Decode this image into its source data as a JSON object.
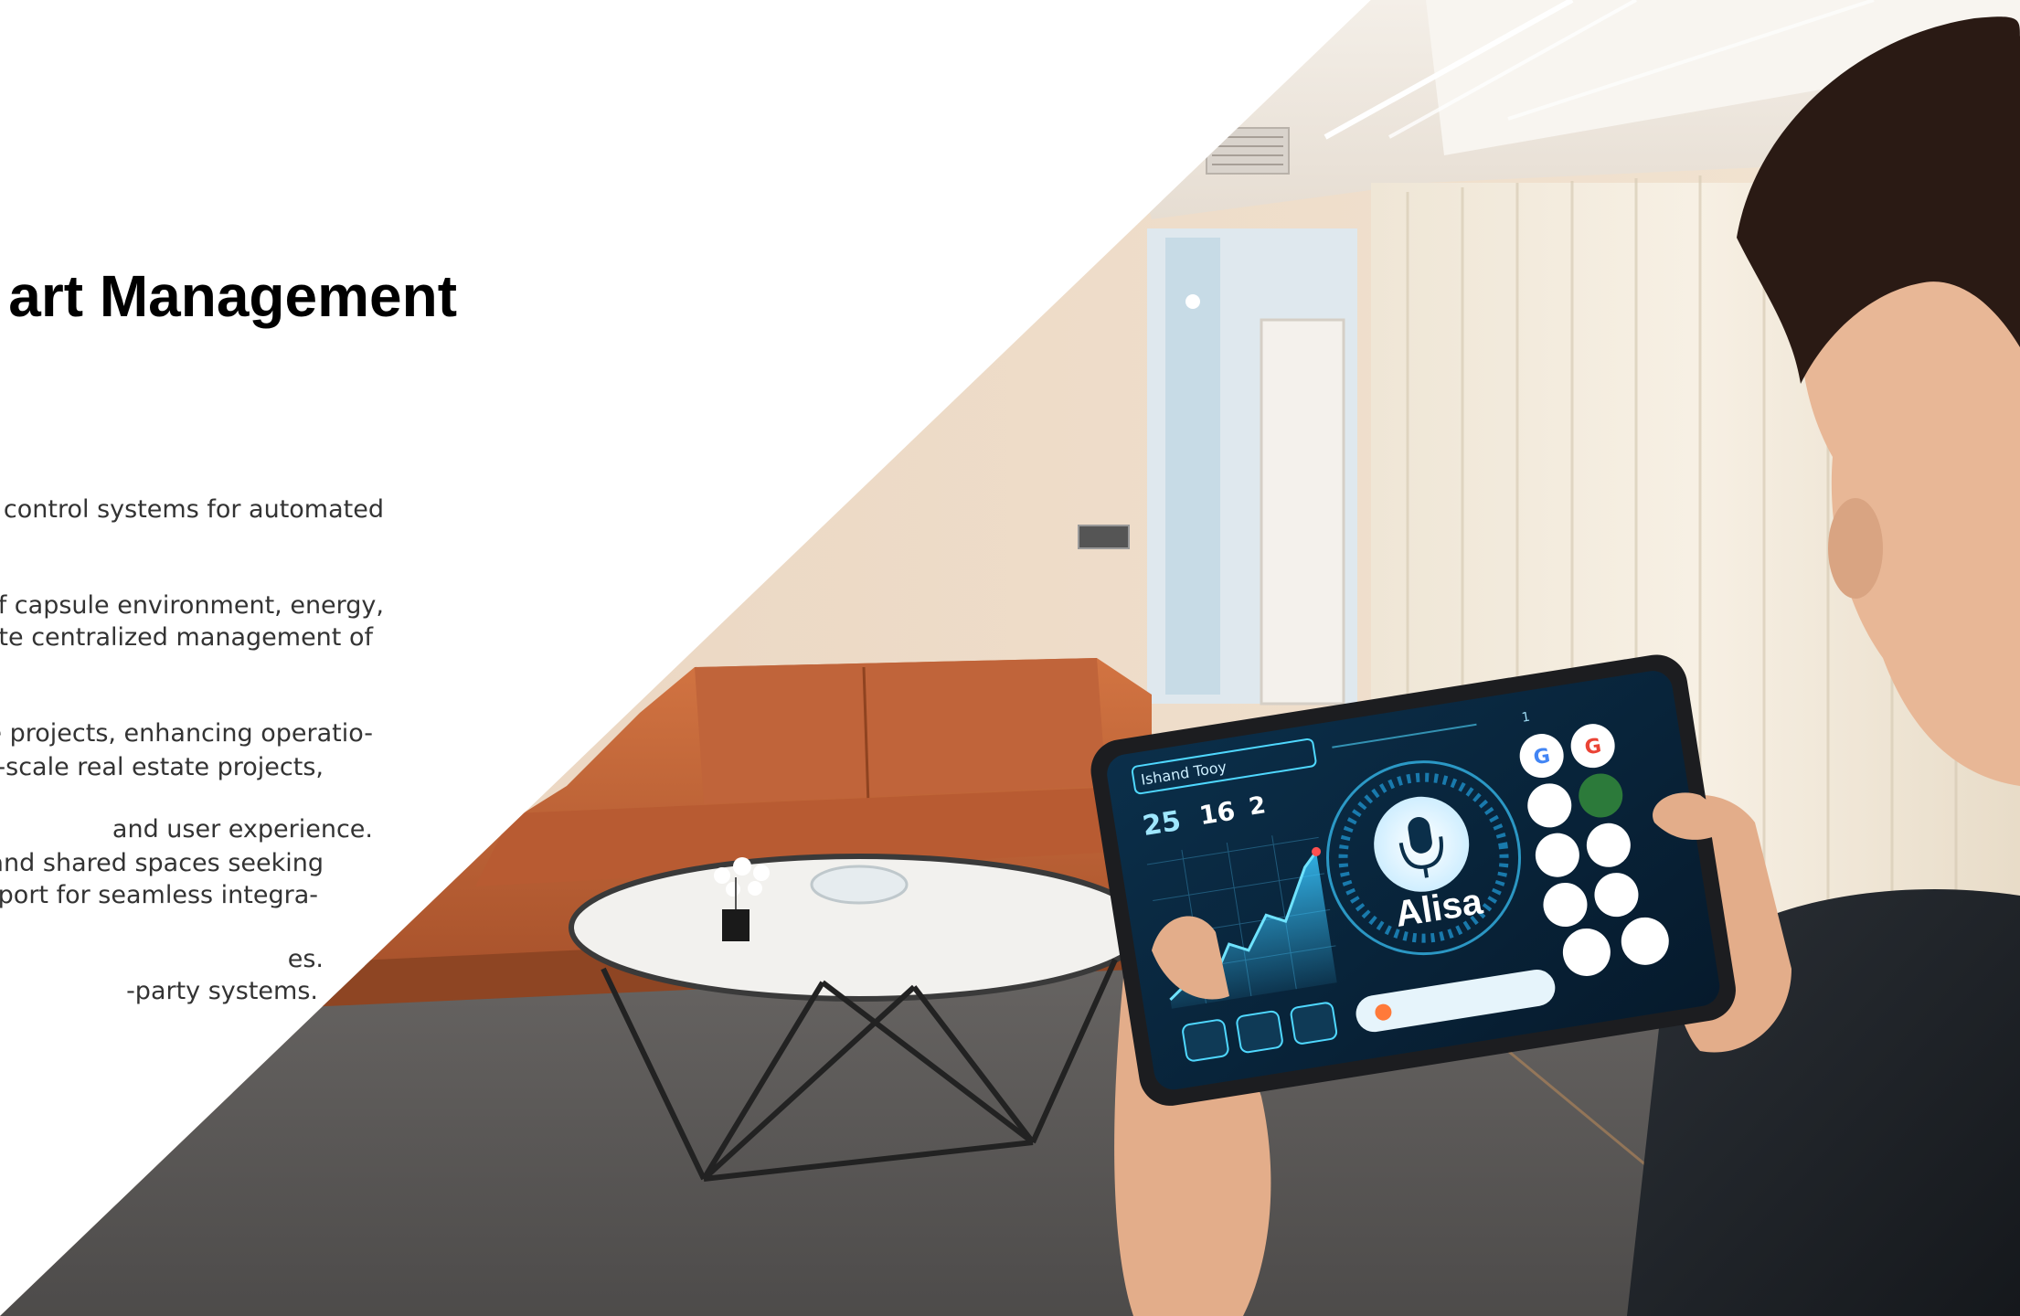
{
  "title": "art Management",
  "paragraphs": [
    [
      "AI control systems for automated",
      "of capsule environment, energy,"
    ],
    [
      "ote centralized management of",
      "le projects, enhancing operatio-",
      "and user experience."
    ],
    [
      "ge-scale real estate projects,",
      "and shared spaces seeking",
      "es."
    ],
    [
      "pport for seamless integra-",
      "-party systems."
    ]
  ],
  "tablet": {
    "header_label": "Ishand Tooy",
    "stats": [
      "25",
      "16",
      "2"
    ],
    "brand": "Alisa",
    "corner_code": "1"
  },
  "colors": {
    "title": "#000000",
    "body_text": "#333333",
    "sofa": "#c96a3a",
    "tablet_accent": "#4fd8ff"
  }
}
